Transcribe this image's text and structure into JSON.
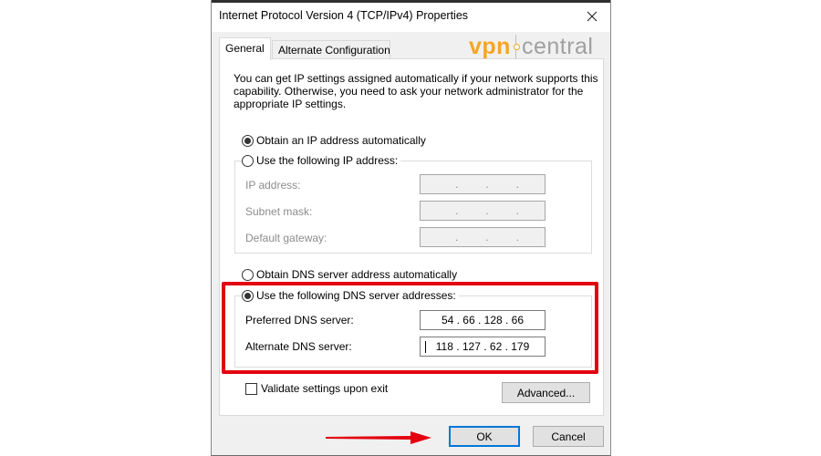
{
  "window": {
    "title": "Internet Protocol Version 4 (TCP/IPv4) Properties",
    "close_icon": "close-icon"
  },
  "tabs": [
    {
      "label": "General",
      "active": true
    },
    {
      "label": "Alternate Configuration",
      "active": false
    }
  ],
  "watermark": {
    "part1": "vpn",
    "part2": "central",
    "colors": {
      "vpn": "#f5a623",
      "central": "#a0a0a0"
    }
  },
  "description": "You can get IP settings assigned automatically if your network supports this capability. Otherwise, you need to ask your network administrator for the appropriate IP settings.",
  "ip_settings": {
    "obtain_auto": {
      "label": "Obtain an IP address automatically",
      "checked": true
    },
    "use_following": {
      "label": "Use the following IP address:",
      "checked": false
    },
    "fields": [
      {
        "label": "IP address:",
        "value": ". . .",
        "enabled": false
      },
      {
        "label": "Subnet mask:",
        "value": ". . .",
        "enabled": false
      },
      {
        "label": "Default gateway:",
        "value": ". . .",
        "enabled": false
      }
    ]
  },
  "dns_settings": {
    "obtain_auto": {
      "label": "Obtain DNS server address automatically",
      "checked": false
    },
    "use_following": {
      "label": "Use the following DNS server addresses:",
      "checked": true
    },
    "preferred": {
      "label": "Preferred DNS server:",
      "value": "54 . 66 . 128 . 66"
    },
    "alternate": {
      "label": "Alternate DNS server:",
      "value": "118 . 127 . 62 . 179"
    }
  },
  "validate": {
    "label": "Validate settings upon exit",
    "checked": false
  },
  "buttons": {
    "advanced": "Advanced...",
    "ok": "OK",
    "cancel": "Cancel"
  },
  "annotations": {
    "highlight_color": "#e3000f",
    "arrow_color": "#e3000f"
  }
}
